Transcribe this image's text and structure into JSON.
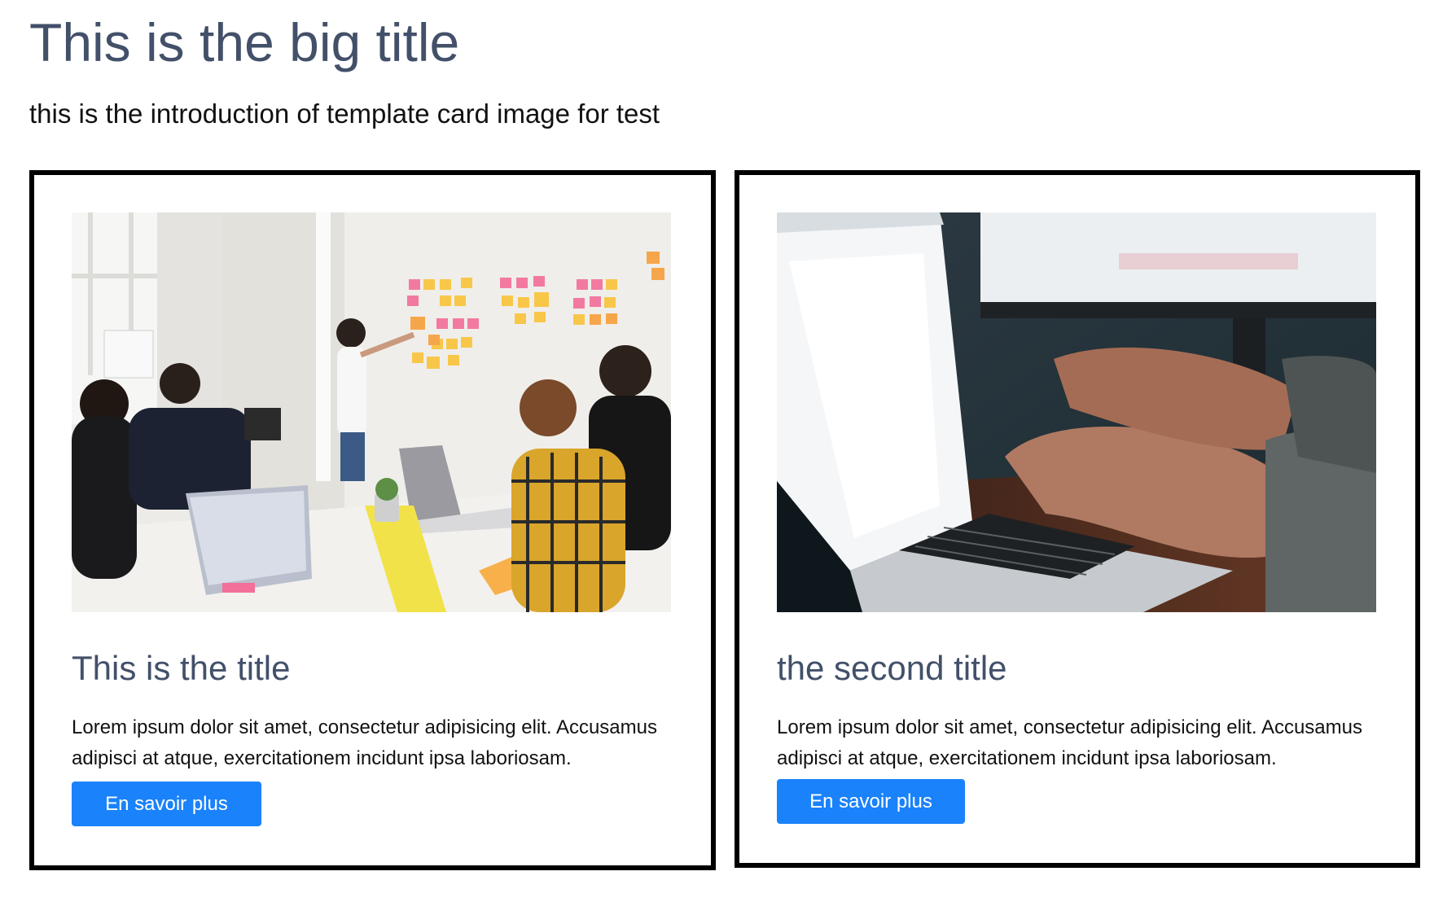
{
  "header": {
    "title": "This is the big title",
    "intro": "this is the introduction of template card image for test"
  },
  "cards": [
    {
      "image_description": "team meeting with sticky notes",
      "title": "This is the title",
      "text": "Lorem ipsum dolor sit amet, consectetur adipisicing elit. Accusamus adipisci at atque, exercitationem incidunt ipsa laboriosam.",
      "button_label": "En savoir plus"
    },
    {
      "image_description": "hands typing on laptop",
      "title": "the second title",
      "text": "Lorem ipsum dolor sit amet, consectetur adipisicing elit. Accusamus adipisci at atque, exercitationem incidunt ipsa laboriosam.",
      "button_label": "En savoir plus"
    }
  ],
  "colors": {
    "title": "#43506a",
    "button": "#1a82fb",
    "border": "#000000"
  }
}
